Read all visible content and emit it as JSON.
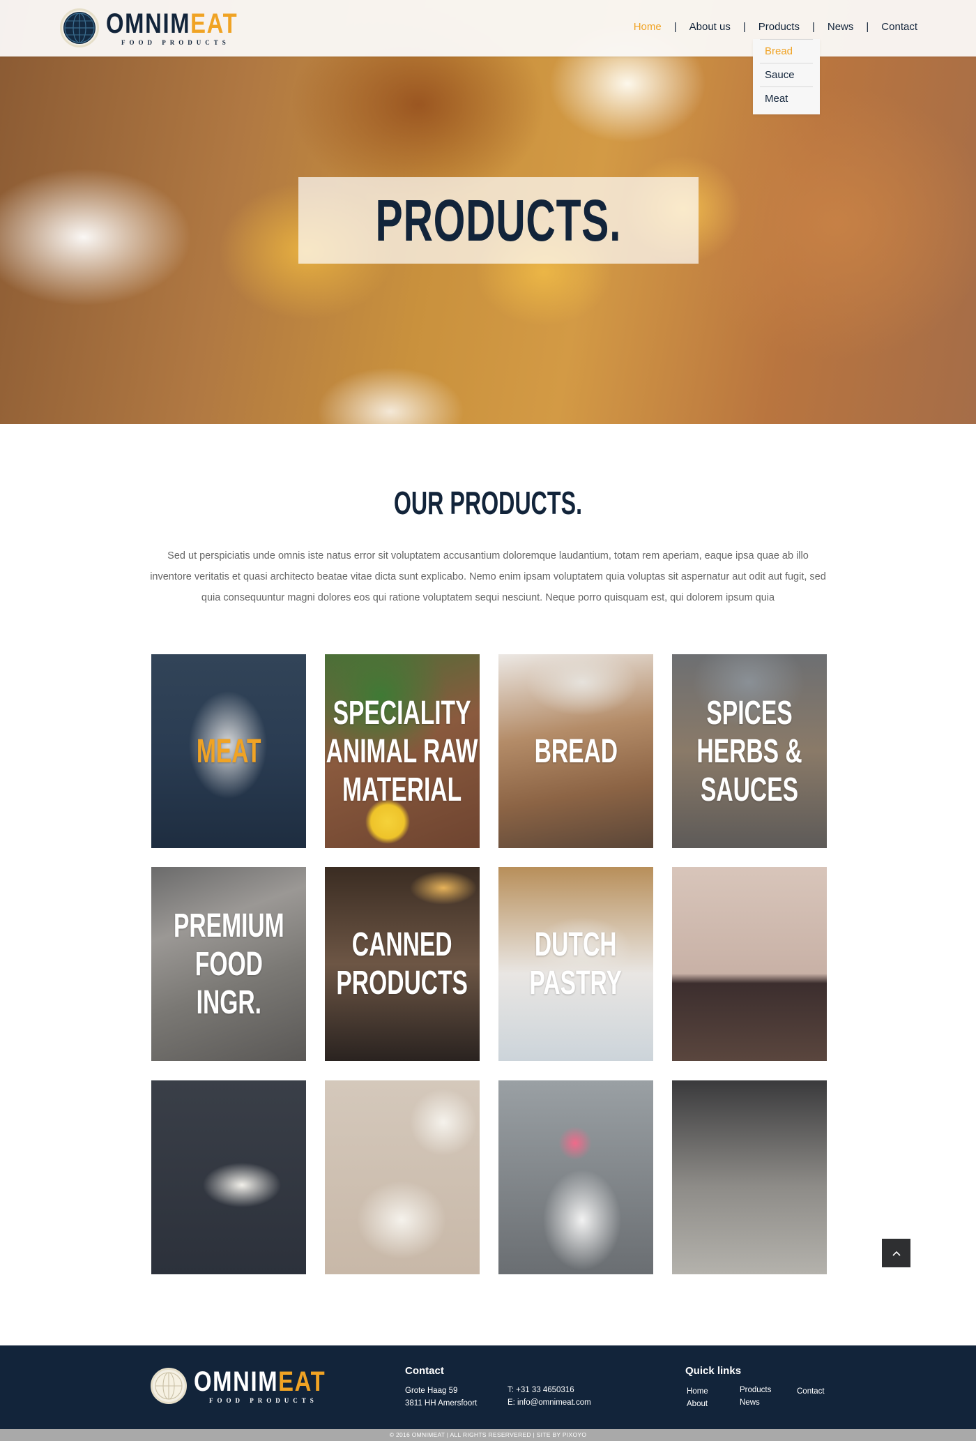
{
  "brand": {
    "name_part1": "OMNIM",
    "name_part2": "EAT",
    "tagline": "FOOD PRODUCTS",
    "accent_color": "#f0a324",
    "primary_color": "#12243a"
  },
  "nav": {
    "items": [
      {
        "label": "Home",
        "active": true
      },
      {
        "label": "About us",
        "active": false
      },
      {
        "label": "Products",
        "active": false
      },
      {
        "label": "News",
        "active": false
      },
      {
        "label": "Contact",
        "active": false
      }
    ],
    "separator": "|",
    "products_dropdown": [
      {
        "label": "Bread",
        "active": true
      },
      {
        "label": "Sauce",
        "active": false
      },
      {
        "label": "Meat",
        "active": false
      }
    ]
  },
  "hero": {
    "title": "PRODUCTS."
  },
  "intro": {
    "title": "OUR PRODUCTS.",
    "body": "Sed ut perspiciatis unde omnis iste natus error sit voluptatem accusantium doloremque laudantium, totam rem aperiam, eaque ipsa quae ab illo inventore veritatis et quasi architecto beatae vitae dicta sunt explicabo. Nemo enim ipsam voluptatem quia voluptas sit aspernatur aut odit aut fugit, sed quia consequuntur magni dolores eos qui ratione voluptatem sequi nesciunt. Neque porro quisquam est, qui dolorem ipsum quia"
  },
  "products": [
    {
      "lines": [
        "MEAT"
      ],
      "highlight": true
    },
    {
      "lines": [
        "SPECIALITY",
        "ANIMAL RAW",
        "MATERIAL"
      ],
      "highlight": false
    },
    {
      "lines": [
        "BREAD"
      ],
      "highlight": false
    },
    {
      "lines": [
        "SPICES",
        "HERBS &",
        "SAUCES"
      ],
      "highlight": false
    },
    {
      "lines": [
        "PREMIUM",
        "FOOD",
        "INGR."
      ],
      "highlight": false
    },
    {
      "lines": [
        "CANNED",
        "PRODUCTS"
      ],
      "highlight": false
    },
    {
      "lines": [
        "DUTCH",
        "PASTRY"
      ],
      "highlight": false
    },
    {
      "lines": [],
      "highlight": false
    },
    {
      "lines": [],
      "highlight": false
    },
    {
      "lines": [],
      "highlight": false
    },
    {
      "lines": [],
      "highlight": false
    },
    {
      "lines": [],
      "highlight": false
    }
  ],
  "scroll_top": {
    "icon": "chevron-up-icon"
  },
  "footer": {
    "contact": {
      "title": "Contact",
      "address_line1": "Grote Haag 59",
      "address_line2": "3811 HH Amersfoort",
      "phone": "T: +31 33 4650316",
      "email": "E: info@omnimeat.com"
    },
    "quick_links": {
      "title": "Quick links",
      "col1": [
        "Home",
        "About"
      ],
      "col2": [
        "Products",
        "News"
      ],
      "col3": [
        "Contact"
      ]
    },
    "copyright": "© 2016 OMNIMEAT  |  ALL RIGHTS RESERVERED  |  SITE BY PIXOYO"
  }
}
